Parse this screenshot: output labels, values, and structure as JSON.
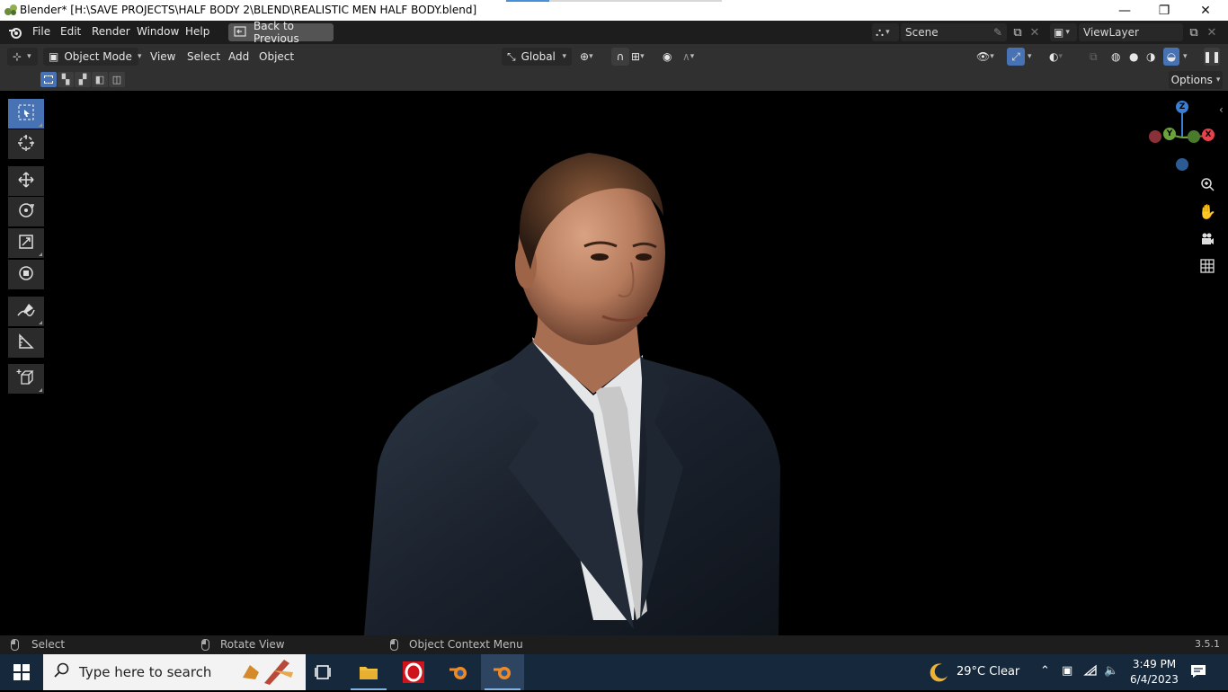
{
  "window": {
    "title": "Blender* [H:\\SAVE PROJECTS\\HALF BODY 2\\BLEND\\REALISTIC MEN HALF BODY.blend]",
    "controls": {
      "minimize": "—",
      "maximize": "❐",
      "close": "✕"
    }
  },
  "menubar": {
    "items": [
      "File",
      "Edit",
      "Render",
      "Window",
      "Help"
    ],
    "back_button": "Back to Previous",
    "scene": "Scene",
    "view_layer": "ViewLayer"
  },
  "header": {
    "mode": "Object Mode",
    "menus": [
      "View",
      "Select",
      "Add",
      "Object"
    ],
    "transform_orientation": "Global"
  },
  "toolsettings": {
    "options": "Options"
  },
  "gizmo": {
    "z": "Z",
    "y": "Y",
    "x": "X"
  },
  "statusbar": {
    "select": "Select",
    "rotate": "Rotate View",
    "context": "Object Context Menu",
    "version": "3.5.1"
  },
  "taskbar": {
    "search_placeholder": "Type here to search",
    "weather": "29°C  Clear",
    "time": "3:49 PM",
    "date": "6/4/2023"
  },
  "colors": {
    "accent": "#4772b3",
    "axis_x": "#e6424c",
    "axis_y": "#6ca23b",
    "axis_z": "#3a7fd5",
    "suit": "#1c2430",
    "shirt": "#e4e6e8",
    "tie": "#c8c8c8",
    "skin": "#c2886a"
  }
}
